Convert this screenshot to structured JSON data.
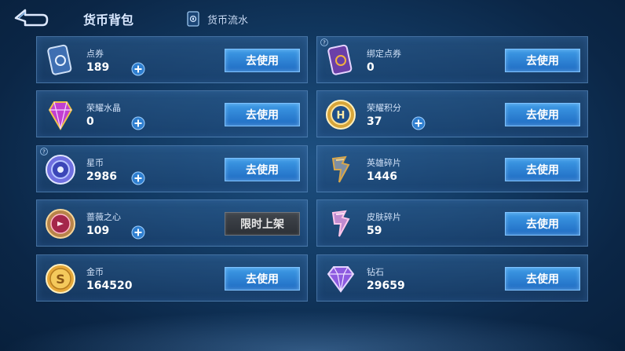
{
  "header": {
    "title": "货币背包",
    "flow_tab_label": "货币流水"
  },
  "currencies": [
    {
      "name": "点券",
      "amount": "189",
      "action": "去使用",
      "icon": "voucher-card-icon",
      "has_plus": true
    },
    {
      "name": "绑定点券",
      "amount": "0",
      "action": "去使用",
      "icon": "bound-voucher-card-icon",
      "has_plus": false,
      "has_info": true
    },
    {
      "name": "荣耀水晶",
      "amount": "0",
      "action": "去使用",
      "icon": "glory-crystal-icon",
      "has_plus": true
    },
    {
      "name": "荣耀积分",
      "amount": "37",
      "action": "去使用",
      "icon": "glory-points-coin-icon",
      "has_plus": true
    },
    {
      "name": "星币",
      "amount": "2986",
      "action": "去使用",
      "icon": "star-coin-icon",
      "has_plus": true,
      "has_info": true
    },
    {
      "name": "英雄碎片",
      "amount": "1446",
      "action": "去使用",
      "icon": "hero-shard-icon",
      "has_plus": false
    },
    {
      "name": "蔷薇之心",
      "amount": "109",
      "action": "限时上架",
      "icon": "rose-heart-icon",
      "has_plus": true
    },
    {
      "name": "皮肤碎片",
      "amount": "59",
      "action": "去使用",
      "icon": "skin-shard-icon",
      "has_plus": false
    },
    {
      "name": "金币",
      "amount": "164520",
      "action": "去使用",
      "icon": "gold-coin-icon",
      "has_plus": false
    },
    {
      "name": "钻石",
      "amount": "29659",
      "action": "去使用",
      "icon": "diamond-icon",
      "has_plus": false
    }
  ],
  "colors": {
    "accent_button": "#2f86d8",
    "limited_button": "#35393f",
    "panel_border": "#78aae1"
  }
}
